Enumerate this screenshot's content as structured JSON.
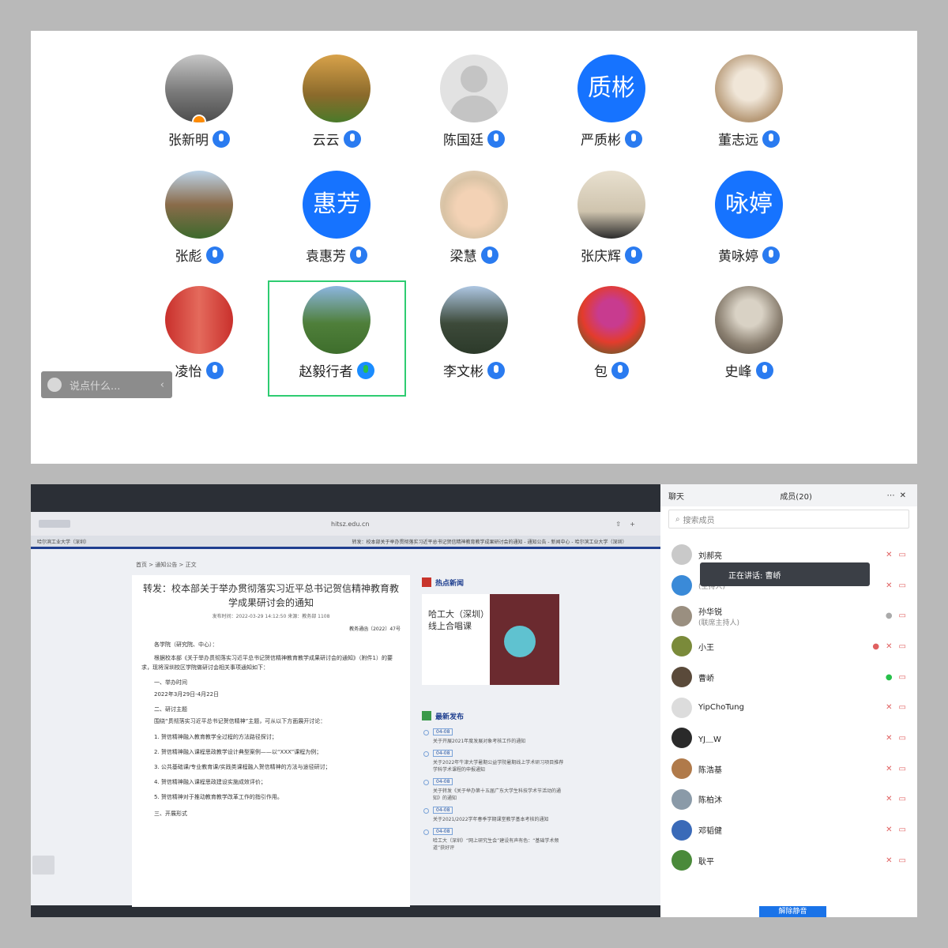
{
  "gallery": {
    "participants": [
      {
        "name": "张新明",
        "avatar": "photo-lake",
        "host": true
      },
      {
        "name": "云云",
        "avatar": "photo-autumn-trees"
      },
      {
        "name": "陈国廷",
        "avatar": "default-person"
      },
      {
        "name": "严质彬",
        "avatar_text": "质彬"
      },
      {
        "name": "董志远",
        "avatar": "sketch-portrait"
      },
      {
        "name": "张彪",
        "avatar": "photo-house"
      },
      {
        "name": "袁惠芳",
        "avatar_text": "惠芳"
      },
      {
        "name": "梁慧",
        "avatar": "painted-child"
      },
      {
        "name": "张庆辉",
        "avatar": "photo-room"
      },
      {
        "name": "黄咏婷",
        "avatar_text": "咏婷"
      },
      {
        "name": "凌怡",
        "avatar": "photo-red-banner"
      },
      {
        "name": "赵毅行者",
        "avatar": "photo-golf",
        "speaking": true
      },
      {
        "name": "李文彬",
        "avatar": "photo-man"
      },
      {
        "name": "包",
        "avatar": "photo-flowers"
      },
      {
        "name": "史峰",
        "avatar": "photo-arches"
      }
    ],
    "chat_input_placeholder": "说点什么..."
  },
  "shared_screen": {
    "browser": {
      "url": "hitsz.edu.cn",
      "tabs": [
        "哈尔滨工业大学（深圳）",
        "转发：校本部关于举办贯彻落实习近平总书记贺信精神教育教学成果研讨会的通知 - 通知公告 - 新闻中心 - 哈尔滨工业大学（深圳）"
      ]
    },
    "breadcrumb": "首页 > 通知公告 > 正文",
    "article": {
      "title": "转发：校本部关于举办贯彻落实习近平总书记贺信精神教育教学成果研讨会的通知",
      "meta": "发布时间：2022-03-29 14:12:50  来源：教务部  1108",
      "doc_no": "教务通函〔2022〕47号",
      "salutation": "各学院（研究院、中心）：",
      "intro": "根据校本部《关于举办贯彻落实习近平总书记贺信精神教育教学成果研讨会的通知》（附件1）的要求，现将深圳校区学院做研讨会相关事项通知如下：",
      "section1": "一、举办时间",
      "dates": "2022年3月29日-4月22日",
      "section2": "二、研讨主题",
      "theme": "围绕“贯彻落实习近平总书记贺信精神”主题，可从以下方面展开讨论：",
      "points": [
        "1. 贺信精神融入教育教学全过程的方法路径探讨；",
        "2. 贺信精神融入课程思政教学设计典型案例——以“XXX”课程为例；",
        "3. 公共基础课/专业教育课/实践类课程融入贺信精神的方法与途径研讨；",
        "4. 贺信精神融入课程思政建设实施成效评价；",
        "5. 贺信精神对于推动教育教学改革工作的指引作用。"
      ],
      "section3": "三、开展形式"
    },
    "hot_news": {
      "label": "热点新闻",
      "card_title": "哈工大（深圳）线上合唱课"
    },
    "latest": {
      "label": "最新发布",
      "items": [
        {
          "date": "04-08",
          "text": "关于开展2021年度发展对象考核工作的通知"
        },
        {
          "date": "04-08",
          "text": "关于2022年牛津大学暑期公益学院暑期线上学术研习项目推荐学科学术课程的申报通知"
        },
        {
          "date": "04-08",
          "text": "关于转发《关于举办第十五届广东大学生科技学术节活动的通知》的通知"
        },
        {
          "date": "04-08",
          "text": "关于2021/2022学年春季学期课堂教学基本考核的通知"
        },
        {
          "date": "04-08",
          "text": "哈工大（深圳）“网上研究生会”建设有声有色：“基础学术频道”获好评"
        }
      ]
    }
  },
  "side_panel": {
    "tab_chat": "聊天",
    "tab_members": "成员(20)",
    "search_placeholder": "搜索成员",
    "speaking_tip": "正在讲话: 曹峤",
    "members": [
      {
        "name": "刘郝亮",
        "role": ""
      },
      {
        "name": "",
        "role": "(主持人)"
      },
      {
        "name": "孙华锐",
        "role": "(联席主持人)"
      },
      {
        "name": "小王",
        "role": ""
      },
      {
        "name": "曹峤",
        "role": ""
      },
      {
        "name": "YipChoTung",
        "role": ""
      },
      {
        "name": "YJ＿W",
        "role": ""
      },
      {
        "name": "陈浩基",
        "role": ""
      },
      {
        "name": "陈柏沐",
        "role": ""
      },
      {
        "name": "邓韬健",
        "role": ""
      },
      {
        "name": "耿平",
        "role": ""
      }
    ],
    "unmute_all": "解除静音"
  }
}
